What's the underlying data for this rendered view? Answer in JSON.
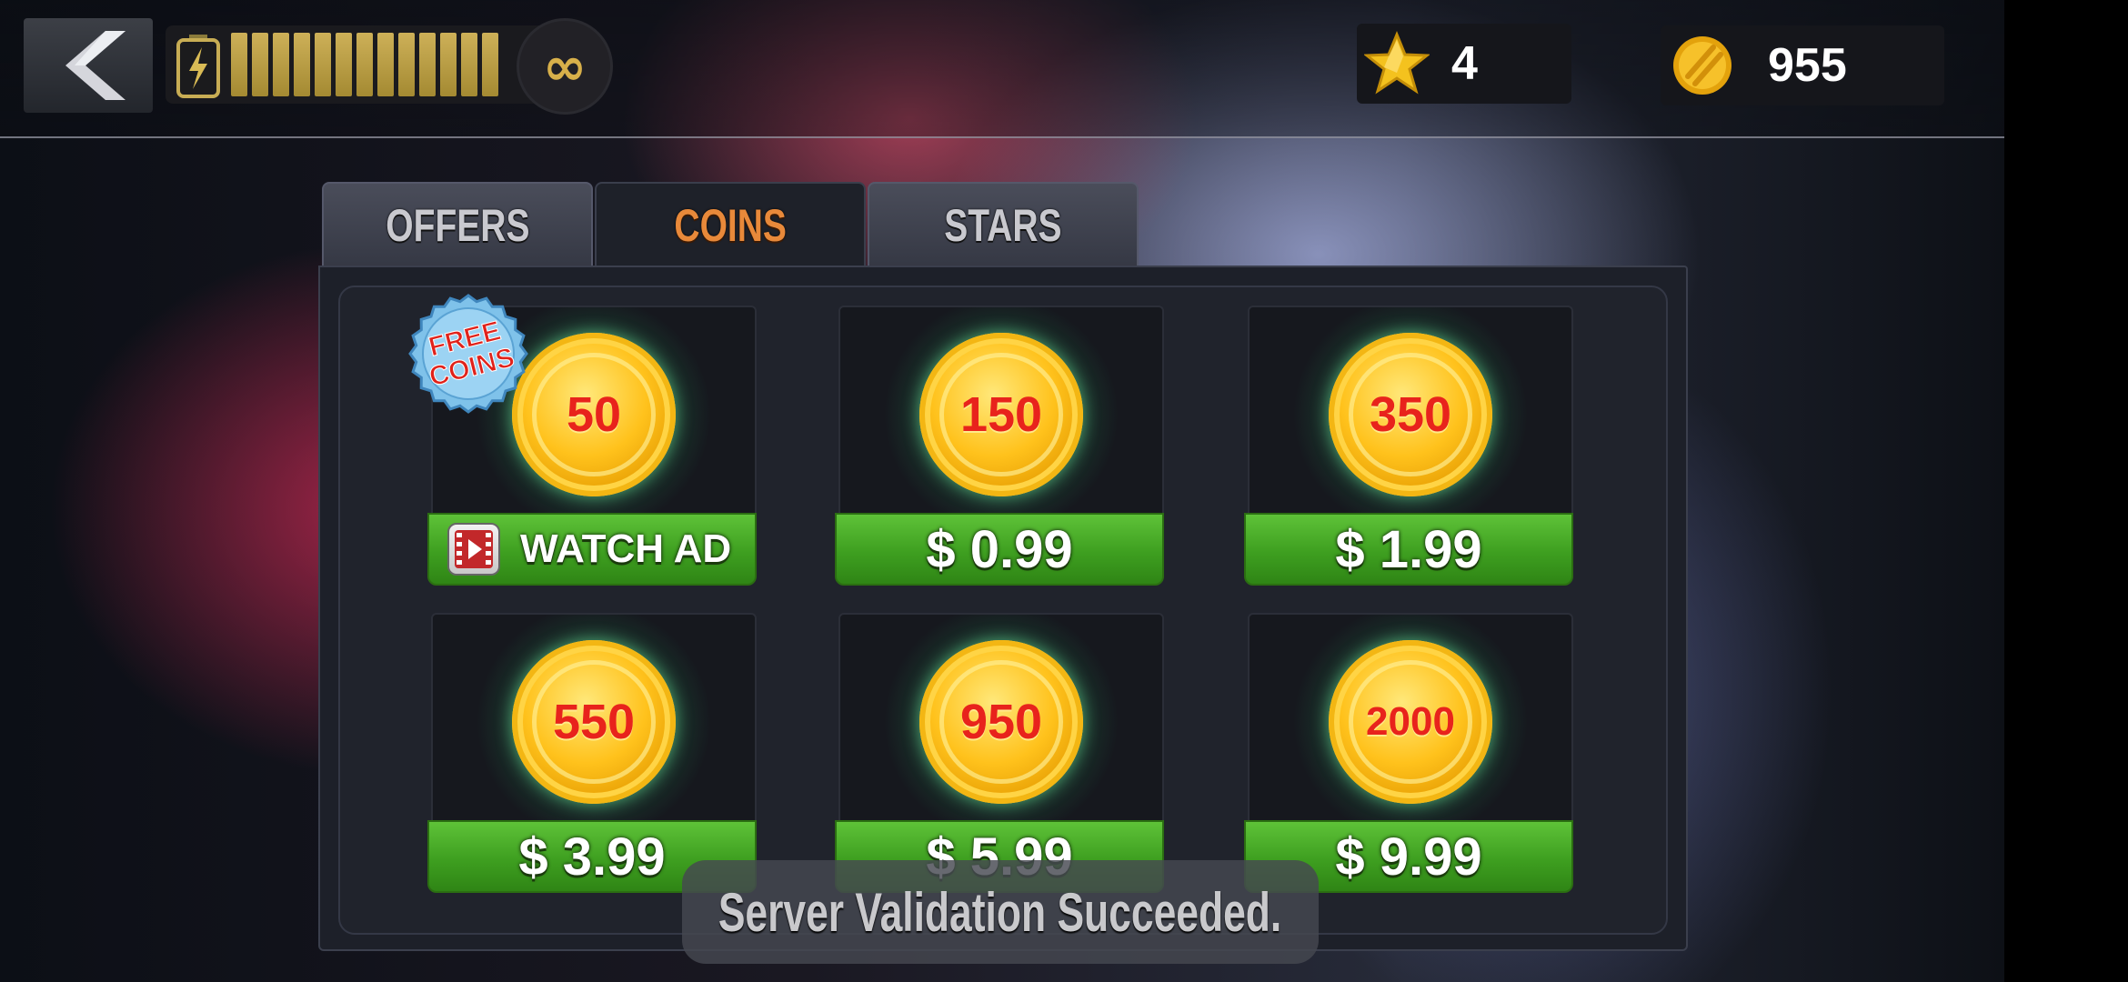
{
  "hud": {
    "energy_bars": 13,
    "infinity_symbol": "∞",
    "stars_count": "4",
    "coins_count": "955",
    "icons": {
      "back": "back-arrow-icon",
      "energy": "battery-bolt-icon",
      "star": "star-icon",
      "coin": "coin-icon"
    }
  },
  "tabs": [
    {
      "label": "OFFERS",
      "active": false
    },
    {
      "label": "COINS",
      "active": true
    },
    {
      "label": "STARS",
      "active": false
    }
  ],
  "badge": {
    "line1": "FREE",
    "line2": "COINS"
  },
  "products": [
    {
      "amount": "50",
      "button": "WATCH AD",
      "type": "ad"
    },
    {
      "amount": "150",
      "button": "$ 0.99",
      "type": "price"
    },
    {
      "amount": "350",
      "button": "$ 1.99",
      "type": "price"
    },
    {
      "amount": "550",
      "button": "$ 3.99",
      "type": "price"
    },
    {
      "amount": "950",
      "button": "$ 5.99",
      "type": "price"
    },
    {
      "amount": "2000",
      "button": "$ 9.99",
      "type": "price"
    }
  ],
  "toast": {
    "message": "Server Validation Succeeded."
  },
  "colors": {
    "accent_tab": "#e8893a",
    "price_green": "#3e9f20",
    "coin_gold": "#ffc21c",
    "coin_text": "#e8231c"
  }
}
